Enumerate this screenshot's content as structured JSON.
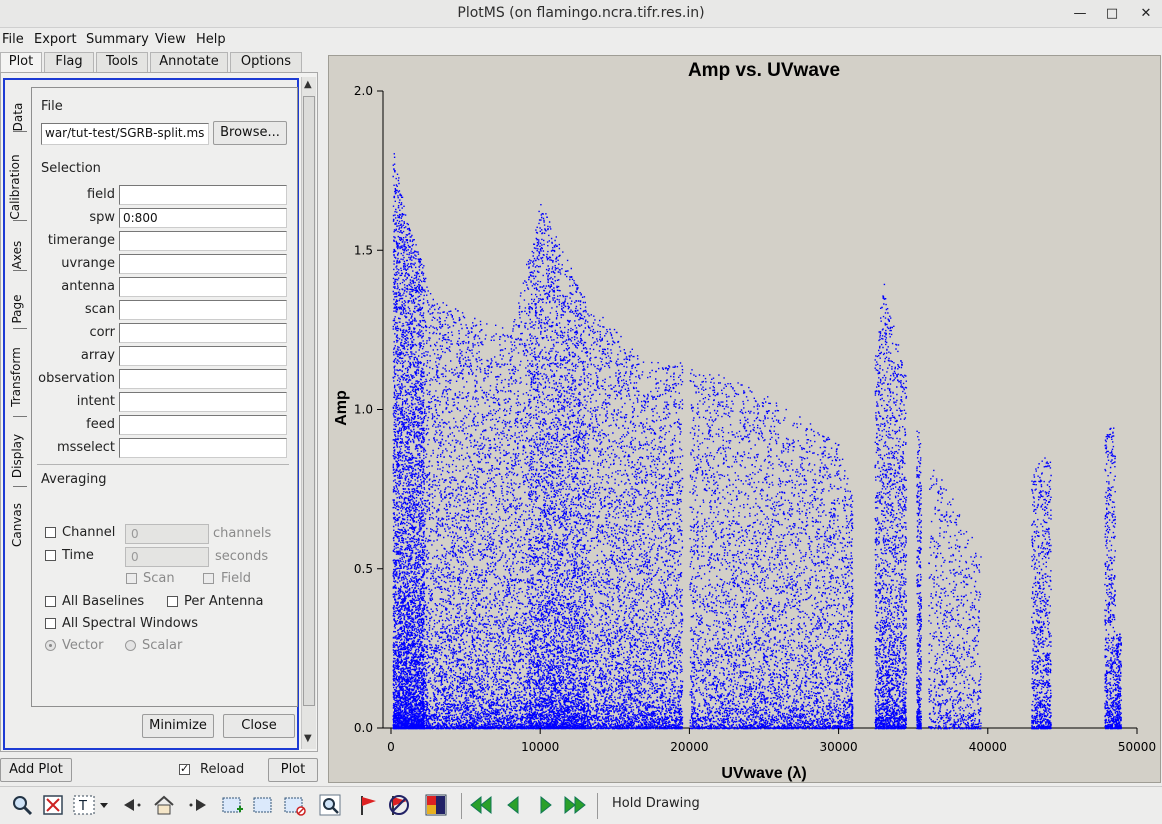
{
  "window": {
    "title": "PlotMS (on flamingo.ncra.tifr.res.in)",
    "minimize_glyph": "—",
    "maximize_glyph": "□",
    "close_glyph": "✕"
  },
  "menubar": [
    "File",
    "Export",
    "Summary",
    "View",
    "Help"
  ],
  "tabs": [
    "Plot",
    "Flag",
    "Tools",
    "Annotate",
    "Options"
  ],
  "vtabs": [
    "Data",
    "Calibration",
    "Axes",
    "Page",
    "Transform",
    "Display",
    "Canvas"
  ],
  "data_panel": {
    "file_heading": "File",
    "file_value": "war/tut-test/SGRB-split.ms",
    "browse_label": "Browse...",
    "selection_heading": "Selection",
    "fields": [
      {
        "label": "field",
        "value": ""
      },
      {
        "label": "spw",
        "value": "0:800"
      },
      {
        "label": "timerange",
        "value": ""
      },
      {
        "label": "uvrange",
        "value": ""
      },
      {
        "label": "antenna",
        "value": ""
      },
      {
        "label": "scan",
        "value": ""
      },
      {
        "label": "corr",
        "value": ""
      },
      {
        "label": "array",
        "value": ""
      },
      {
        "label": "observation",
        "value": ""
      },
      {
        "label": "intent",
        "value": ""
      },
      {
        "label": "feed",
        "value": ""
      },
      {
        "label": "msselect",
        "value": ""
      }
    ],
    "averaging_heading": "Averaging",
    "channel_label": "Channel",
    "channel_value": "0",
    "channel_unit": "channels",
    "time_label": "Time",
    "time_value": "0",
    "time_unit": "seconds",
    "scan_label": "Scan",
    "field_label": "Field",
    "all_baselines_label": "All Baselines",
    "per_antenna_label": "Per Antenna",
    "all_spw_label": "All Spectral Windows",
    "vector_label": "Vector",
    "scalar_label": "Scalar",
    "minimize_label": "Minimize",
    "close_label": "Close"
  },
  "bottom_controls": {
    "add_plot_label": "Add Plot",
    "reload_label": "Reload",
    "reload_checked": true,
    "plot_label": "Plot"
  },
  "toolbar": {
    "hold_drawing_label": "Hold Drawing",
    "icons": [
      "zoom-icon",
      "zoom-fit-icon",
      "annotate-text-icon",
      "back-arrow-icon",
      "home-icon",
      "forward-arrow-icon",
      "select-region-icon",
      "subtract-region-icon",
      "delete-region-icon",
      "locate-icon",
      "flag-icon",
      "unflag-icon",
      "flag-extensions-icon",
      "first-iteration-icon",
      "prev-iteration-icon",
      "next-iteration-icon",
      "last-iteration-icon"
    ]
  },
  "chart_data": {
    "type": "scatter",
    "title": "Amp vs. UVwave",
    "xlabel": "UVwave (λ)",
    "ylabel": "Amp",
    "xlim": [
      0,
      50000
    ],
    "ylim": [
      0.0,
      2.0
    ],
    "xticks": [
      0,
      10000,
      20000,
      30000,
      40000,
      50000
    ],
    "yticks": [
      0.0,
      0.5,
      1.0,
      1.5,
      2.0
    ],
    "ytick_labels": [
      "0.0",
      "0.5",
      "1.0",
      "1.5",
      "2.0"
    ],
    "marker_color": "#0000ff",
    "background_color": "#d3d0c8",
    "density_profile": {
      "x": [
        0,
        1000,
        3000,
        5000,
        8000,
        10000,
        13000,
        17000,
        20000,
        25000,
        30000,
        31000,
        33000,
        35500,
        38000,
        40000,
        43500,
        44000,
        48500
      ],
      "amp_extent": [
        1.85,
        1.6,
        1.35,
        1.3,
        1.25,
        1.65,
        1.35,
        1.15,
        1.15,
        1.05,
        0.9,
        0.7,
        1.4,
        0.9,
        0.7,
        0.5,
        0.85,
        0.85,
        0.95
      ]
    }
  }
}
